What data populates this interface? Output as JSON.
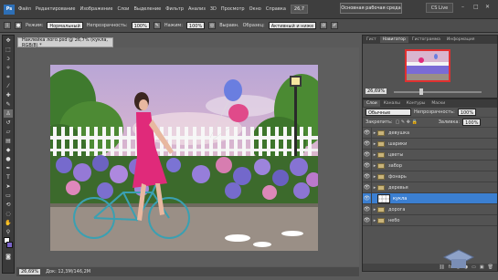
{
  "menubar": {
    "logo": "Ps",
    "items": [
      "Файл",
      "Редактирование",
      "Изображение",
      "Слои",
      "Выделение",
      "Фильтр",
      "Анализ",
      "3D",
      "Просмотр",
      "Окно",
      "Справка"
    ],
    "zoom": "26,7",
    "workspace_button": "Основная рабочая среда",
    "cs_live": "CS Live"
  },
  "options": {
    "mode_label": "Режим:",
    "mode_value": "Нормальный",
    "opacity_label": "Непрозрачность:",
    "opacity_value": "100%",
    "pressure_label": "Нажим:",
    "pressure_value": "100%",
    "all_layers_label": "Выравн.",
    "sample_label": "Образец:",
    "sample_value": "Активный и ниже"
  },
  "document": {
    "tab_title": "Наклейка лого.psd @ 26,7% (кукла, RGB/8) *",
    "status_zoom": "26,69%",
    "status_info": "Док: 12,3M/146,2M"
  },
  "navigator": {
    "tabs": [
      "Гист",
      "Навигатор",
      "Гистограмма",
      "Информация"
    ],
    "active_tab": 1,
    "zoom": "26,69%"
  },
  "layers": {
    "tabs": [
      "Слои",
      "Каналы",
      "Контуры",
      "Маски"
    ],
    "blend_mode": "Обычные",
    "opacity_label": "Непрозрачность:",
    "opacity_value": "100%",
    "lock_label": "Закрепить:",
    "fill_label": "Заливка:",
    "fill_value": "100%",
    "items": [
      {
        "name": "девушка",
        "type": "folder",
        "selected": false
      },
      {
        "name": "шарики",
        "type": "folder",
        "selected": false
      },
      {
        "name": "цветы",
        "type": "folder",
        "selected": false
      },
      {
        "name": "забор",
        "type": "folder",
        "selected": false
      },
      {
        "name": "фонарь",
        "type": "folder",
        "selected": false
      },
      {
        "name": "деревья",
        "type": "folder",
        "selected": false
      },
      {
        "name": "кукла",
        "type": "layer",
        "selected": true
      },
      {
        "name": "дорога",
        "type": "folder",
        "selected": false
      },
      {
        "name": "небо",
        "type": "folder",
        "selected": false
      }
    ]
  },
  "colors": {
    "accent": "#3b7fd1",
    "panel_bg": "#535353"
  }
}
